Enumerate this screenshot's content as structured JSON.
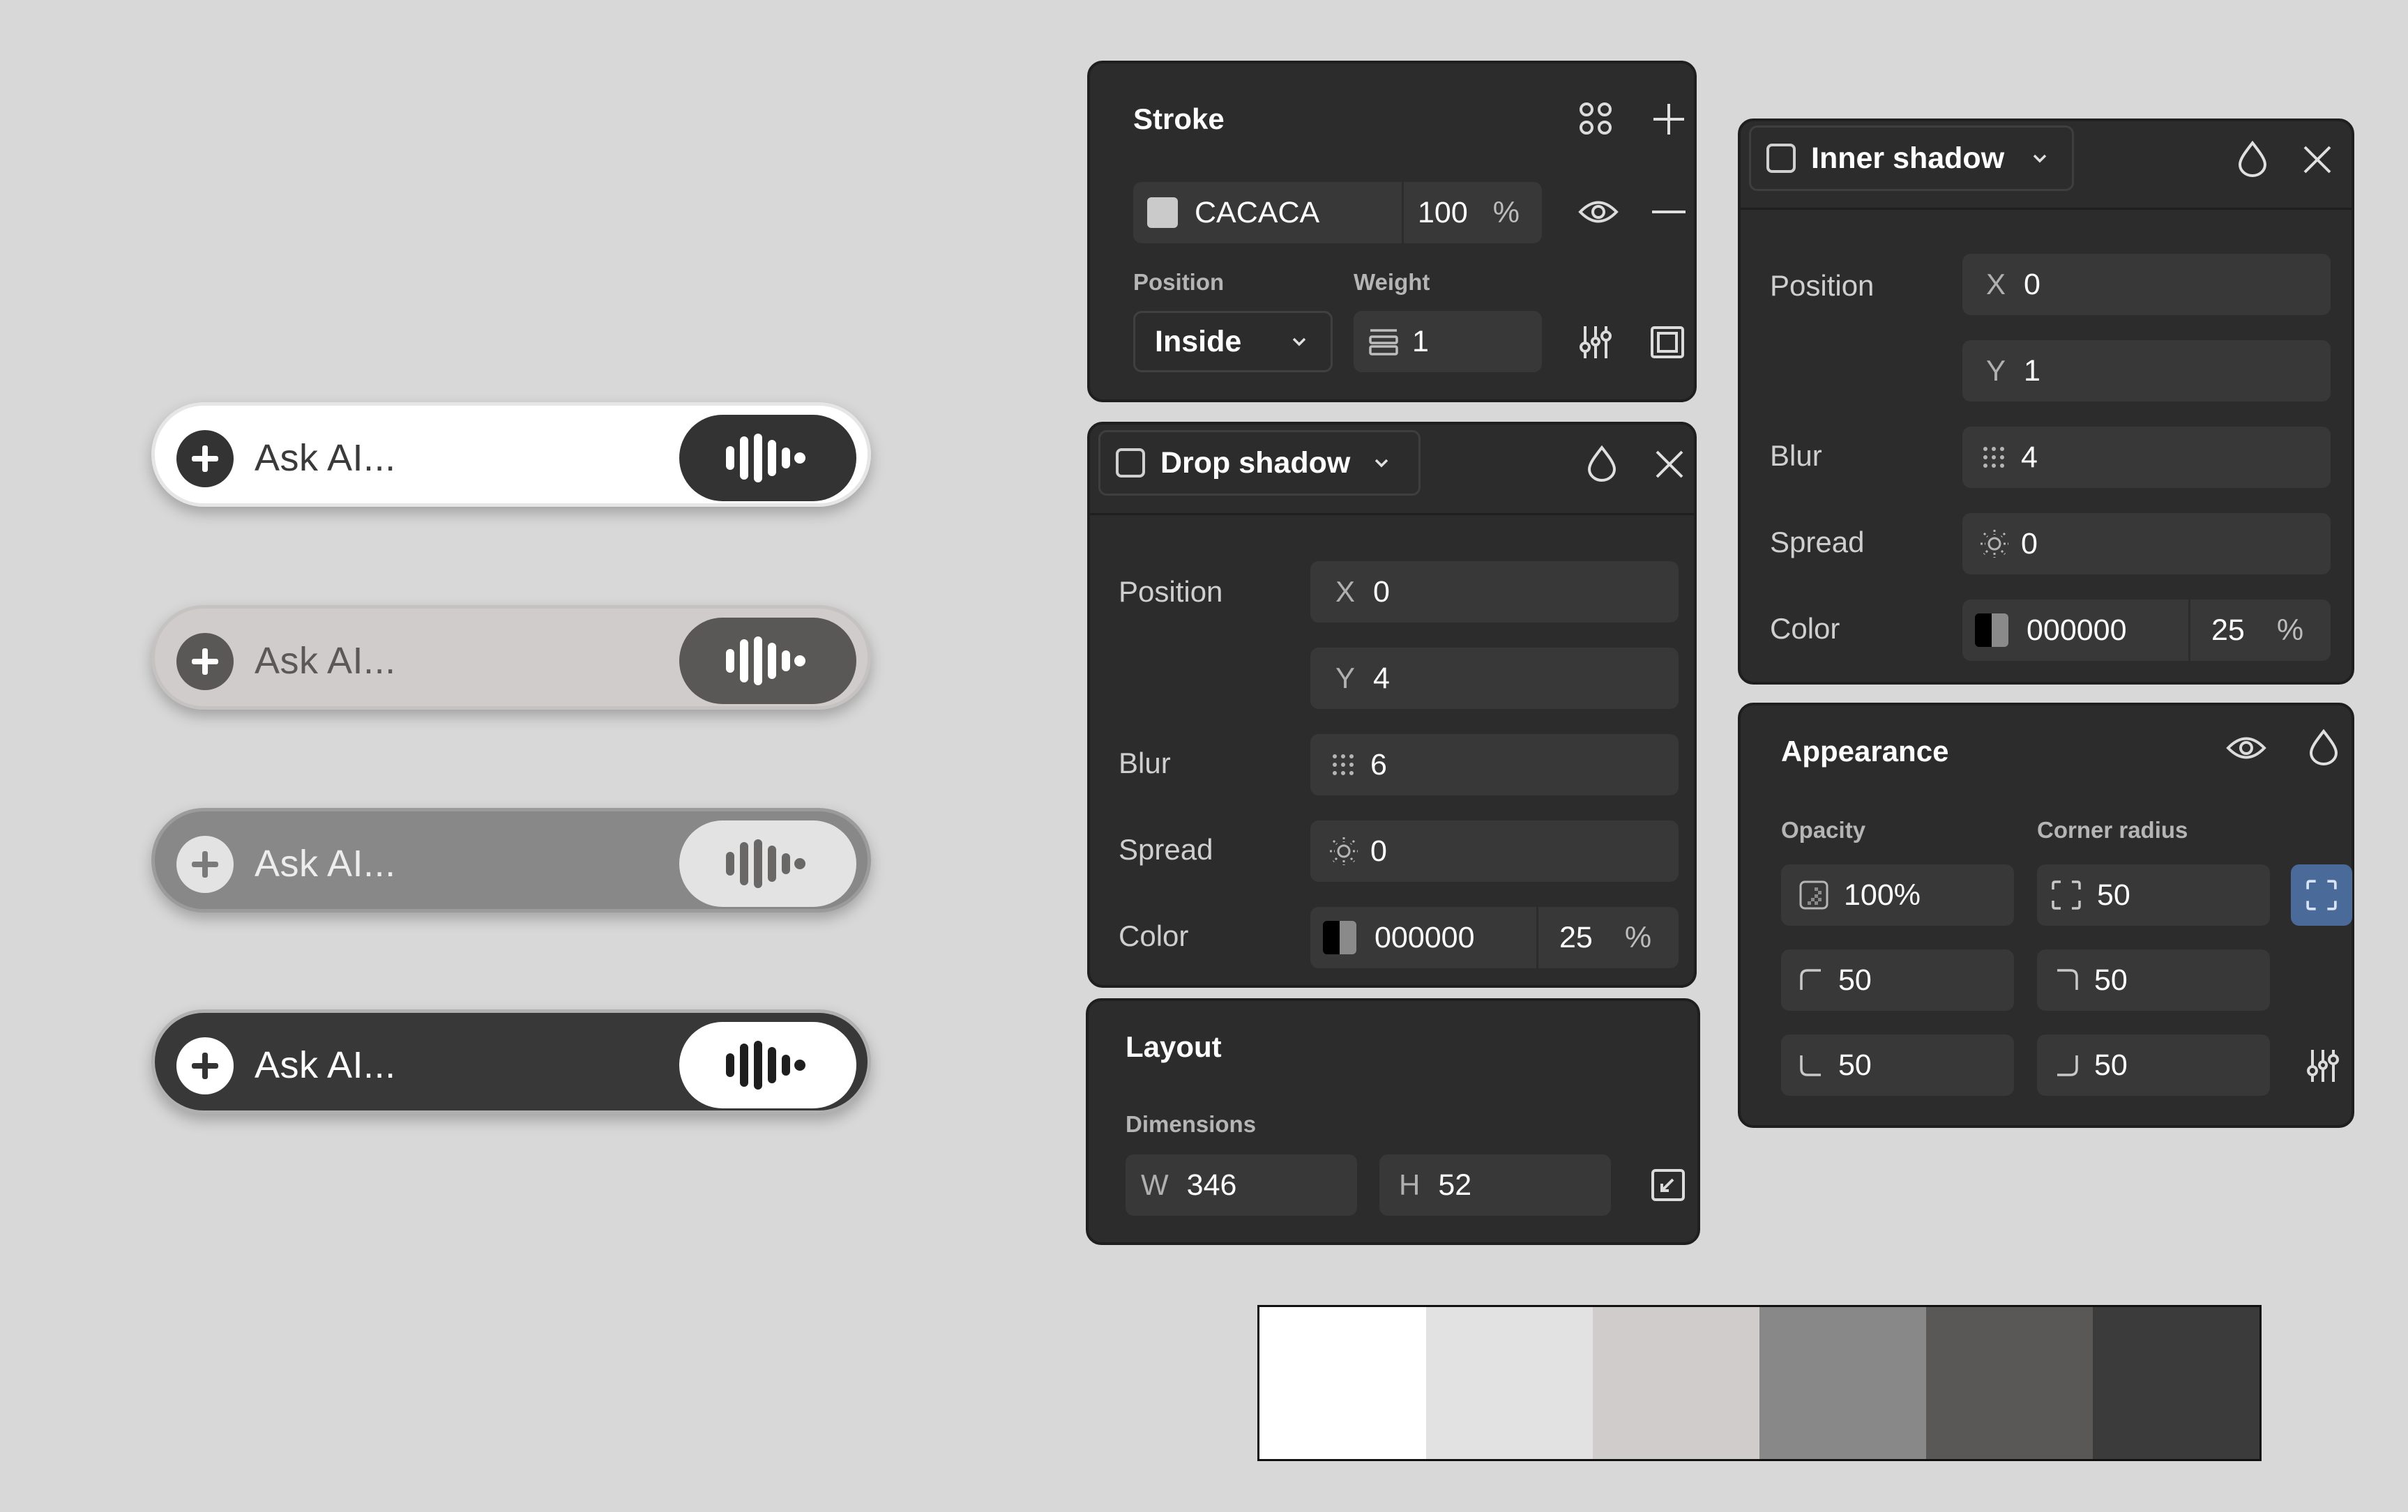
{
  "pills": [
    {
      "placeholder": "Ask AI...",
      "plus_icon": "plus-icon",
      "mic_icon": "waveform-icon"
    },
    {
      "placeholder": "Ask AI...",
      "plus_icon": "plus-icon",
      "mic_icon": "waveform-icon"
    },
    {
      "placeholder": "Ask AI...",
      "plus_icon": "plus-icon",
      "mic_icon": "waveform-icon"
    },
    {
      "placeholder": "Ask AI...",
      "plus_icon": "plus-icon",
      "mic_icon": "waveform-icon"
    }
  ],
  "stroke": {
    "title": "Stroke",
    "color_hex": "CACACA",
    "color_swatch": "#cacaca",
    "opacity": "100",
    "opacity_unit": "%",
    "position_label": "Position",
    "weight_label": "Weight",
    "position_value": "Inside",
    "weight_value": "1"
  },
  "drop_shadow": {
    "type_label": "Drop shadow",
    "position_label": "Position",
    "x_label": "X",
    "x_value": "0",
    "y_label": "Y",
    "y_value": "4",
    "blur_label": "Blur",
    "blur_value": "6",
    "spread_label": "Spread",
    "spread_value": "0",
    "color_label": "Color",
    "color_hex": "000000",
    "color_opacity": "25",
    "opacity_unit": "%"
  },
  "inner_shadow": {
    "type_label": "Inner shadow",
    "position_label": "Position",
    "x_label": "X",
    "x_value": "0",
    "y_label": "Y",
    "y_value": "1",
    "blur_label": "Blur",
    "blur_value": "4",
    "spread_label": "Spread",
    "spread_value": "0",
    "color_label": "Color",
    "color_hex": "000000",
    "color_opacity": "25",
    "opacity_unit": "%"
  },
  "appearance": {
    "title": "Appearance",
    "opacity_label": "Opacity",
    "corner_label": "Corner radius",
    "opacity_value": "100%",
    "radius_all": "50",
    "radius_tl": "50",
    "radius_tr": "50",
    "radius_bl": "50",
    "radius_br": "50"
  },
  "layout": {
    "title": "Layout",
    "dimensions_label": "Dimensions",
    "w_label": "W",
    "w_value": "346",
    "h_label": "H",
    "h_value": "52"
  },
  "palette": [
    "#ffffff",
    "#e2e2e2",
    "#d0cccc",
    "#888888",
    "#5a5757",
    "#3b3b3b"
  ],
  "colors": {
    "panel_bg": "#2c2c2c",
    "field_bg": "#383838",
    "accent": "#4a6a9a"
  }
}
